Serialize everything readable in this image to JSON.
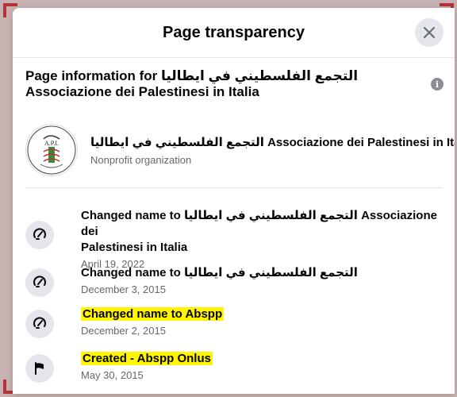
{
  "dialog": {
    "title": "Page transparency",
    "info_title_line1": "Page information for التجمع الفلسطيني في ايطاليا",
    "info_title_line2": "Associazione dei Palestinesi in Italia"
  },
  "page": {
    "name": "التجمع الفلسطيني في ايطاليا Associazione dei Palestinesi in Italia",
    "type": "Nonprofit organization",
    "logo_text": "A.P.I."
  },
  "history": [
    {
      "icon": "name-change-icon",
      "title": "Changed name to التجمع الفلسطيني في ايطاليا Associazione dei",
      "title2": "Palestinesi in Italia",
      "date": "April 19, 2022",
      "highlight": false
    },
    {
      "icon": "name-change-icon",
      "title": "Changed name to التجمع الفلسطيني في ايطاليا",
      "title2": "",
      "date": "December 3, 2015",
      "highlight": false
    },
    {
      "icon": "name-change-icon",
      "title": "Changed name to Abspp",
      "title2": "",
      "date": "December 2, 2015",
      "highlight": true
    },
    {
      "icon": "flag-icon",
      "title": "Created - Abspp Onlus",
      "title2": "",
      "date": "May 30, 2015",
      "highlight": true
    }
  ],
  "colors": {
    "highlight": "#fff500",
    "backdrop": "#c9b2b2",
    "bracket": "#b5333b"
  }
}
